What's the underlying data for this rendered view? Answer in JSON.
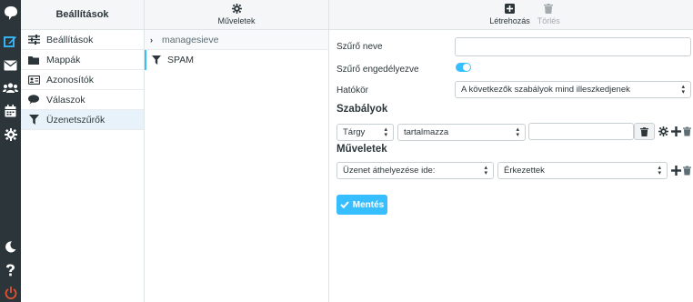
{
  "rail": {
    "icons": [
      "logo-icon",
      "compose-icon",
      "mail-icon",
      "contacts-icon",
      "calendar-icon",
      "settings-icon",
      "dark-mode-icon",
      "help-icon",
      "logout-icon"
    ]
  },
  "settings_nav": {
    "title": "Beállítások",
    "items": [
      {
        "label": "Beállítások",
        "icon": "sliders-icon"
      },
      {
        "label": "Mappák",
        "icon": "folder-icon"
      },
      {
        "label": "Azonosítók",
        "icon": "id-card-icon"
      },
      {
        "label": "Válaszok",
        "icon": "comment-icon"
      },
      {
        "label": "Üzenetszűrők",
        "icon": "filter-icon",
        "active": true
      }
    ]
  },
  "filters": {
    "toolbar_label": "Műveletek",
    "set_name": "managesieve",
    "items": [
      {
        "label": "SPAM"
      }
    ]
  },
  "main": {
    "toolbar": {
      "create_label": "Létrehozás",
      "delete_label": "Törlés"
    },
    "form": {
      "name_label": "Szűrő neve",
      "name_value": "",
      "enabled_label": "Szűrő engedélyezve",
      "enabled": true,
      "scope_label": "Hatókör",
      "scope_value": "A következők szabályok mind illeszkedjenek"
    },
    "rules": {
      "title": "Szabályok",
      "header_value": "Tárgy",
      "operator_value": "tartalmazza",
      "target_value": ""
    },
    "actions": {
      "title": "Műveletek",
      "action_value": "Üzenet áthelyezése ide:",
      "folder_value": "Érkezettek"
    },
    "save_label": "Mentés"
  },
  "colors": {
    "accent": "#37beff",
    "rail_bg": "#2c363a",
    "logout": "#e4512f",
    "compose": "#37beff"
  }
}
